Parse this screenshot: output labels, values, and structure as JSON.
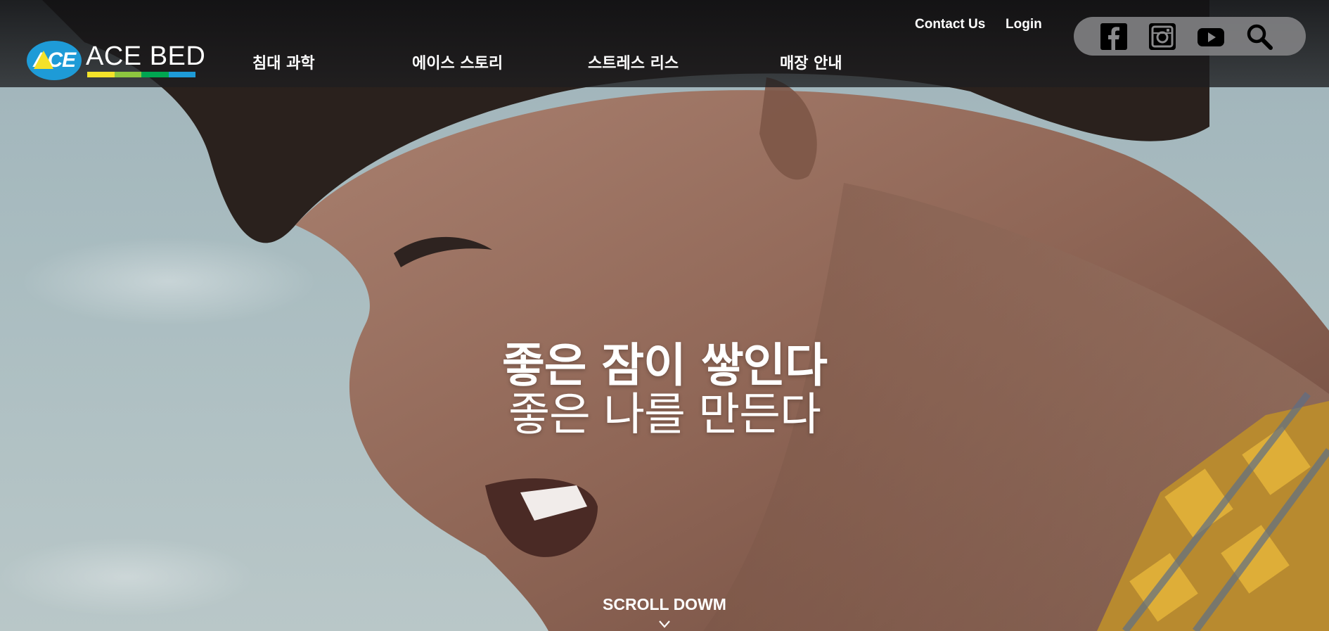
{
  "brand": {
    "logo_mark": "ACE",
    "logo_text": "ACE BED",
    "bar_colors": [
      "#f3e32a",
      "#8dc63f",
      "#00a651",
      "#1e9bd7"
    ]
  },
  "nav": {
    "items": [
      {
        "label": "침대 과학"
      },
      {
        "label": "에이스 스토리"
      },
      {
        "label": "스트레스 리스"
      },
      {
        "label": "매장 안내"
      }
    ]
  },
  "utility": {
    "contact": "Contact Us",
    "login": "Login"
  },
  "social": {
    "icons": [
      "facebook-icon",
      "instagram-icon",
      "youtube-icon",
      "search-icon"
    ]
  },
  "hero": {
    "headline_1": "좋은 잠이 쌓인다",
    "headline_2": "좋은 나를 만든다",
    "scroll_label": "SCROLL DOWM"
  },
  "colors": {
    "accent_blue": "#1e9bd7",
    "header_bg": "#141416"
  }
}
